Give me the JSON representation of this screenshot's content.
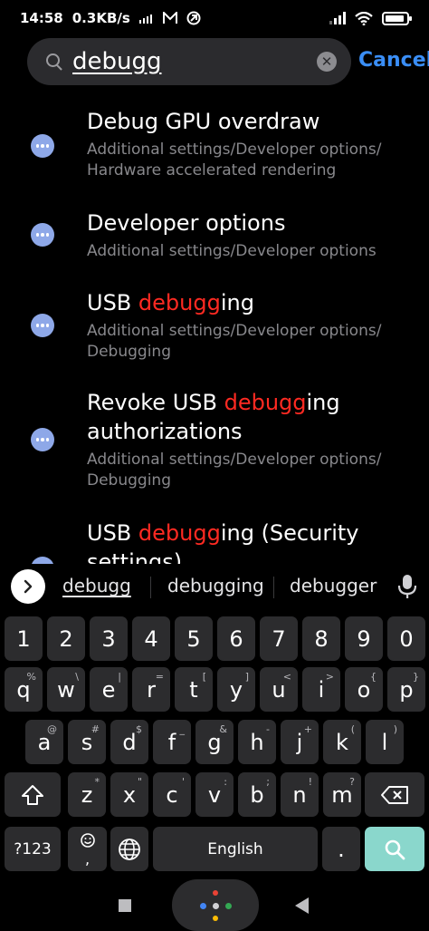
{
  "status": {
    "time": "14:58",
    "speed": "0.3KB/s",
    "battery_level": 0.9
  },
  "search": {
    "query": "debugg",
    "cancel_label": "Cancel"
  },
  "results": [
    {
      "title_parts": [
        "Debug GPU overdraw"
      ],
      "path_lines": [
        "Additional settings/Developer options/",
        "Hardware accelerated rendering"
      ]
    },
    {
      "title_parts": [
        "Developer options"
      ],
      "path_lines": [
        "Additional settings/Developer options"
      ]
    },
    {
      "title_parts": [
        "USB ",
        "debugg",
        "ing"
      ],
      "path_lines": [
        "Additional settings/Developer options/",
        "Debugging"
      ]
    },
    {
      "title_parts": [
        "Revoke USB ",
        "debugg",
        "ing"
      ],
      "title_line2": "authorizations",
      "path_lines": [
        "Additional settings/Developer options/",
        "Debugging"
      ]
    },
    {
      "title_parts": [
        "USB ",
        "debugg",
        "ing (Security"
      ],
      "title_line2": "settings)"
    }
  ],
  "suggestions": [
    "debugg",
    "debugging",
    "debugger"
  ],
  "keyboard": {
    "numbers": [
      "1",
      "2",
      "3",
      "4",
      "5",
      "6",
      "7",
      "8",
      "9",
      "0"
    ],
    "row1": [
      "q",
      "w",
      "e",
      "r",
      "t",
      "y",
      "u",
      "i",
      "o",
      "p"
    ],
    "row1_sup": [
      "%",
      "\\",
      "|",
      "=",
      "[",
      "]",
      "<",
      ">",
      "{",
      "}"
    ],
    "row2": [
      "a",
      "s",
      "d",
      "f",
      "g",
      "h",
      "j",
      "k",
      "l"
    ],
    "row2_sup": [
      "@",
      "#",
      "$",
      "_",
      "&",
      "-",
      "+",
      "(",
      ")"
    ],
    "row3": [
      "z",
      "x",
      "c",
      "v",
      "b",
      "n",
      "m"
    ],
    "row3_sup": [
      "*",
      "\"",
      "'",
      ":",
      ";",
      "!",
      "?"
    ],
    "symbols_label": "?123",
    "emoji_sup": ",",
    "space_label": "English",
    "period": "."
  },
  "colors": {
    "highlight": "#ff2a22",
    "cancel": "#3a8ef6",
    "search_key": "#8ad7cc",
    "result_icon": "#8ea8e8"
  }
}
